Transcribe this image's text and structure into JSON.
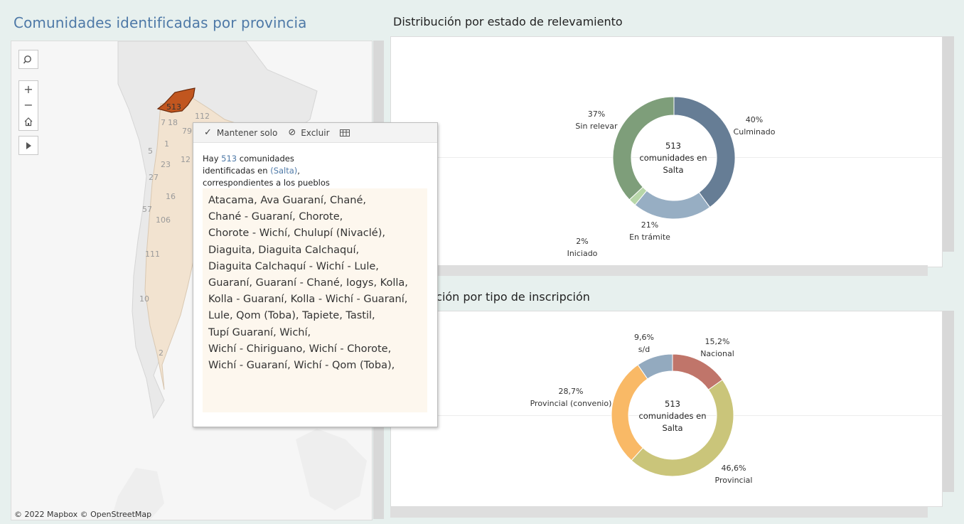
{
  "left": {
    "title": "Comunidades identificadas por provincia",
    "map_labels": [
      "513",
      "112",
      "7",
      "18",
      "79",
      "5",
      "1",
      "12",
      "27",
      "16",
      "57",
      "106",
      "111",
      "10",
      "2",
      "23"
    ],
    "attribution": "© 2022 Mapbox  © OpenStreetMap",
    "controls": {
      "search_icon": "search-icon",
      "zoom_in": "+",
      "zoom_out": "−",
      "home_icon": "home-icon",
      "play_icon": "play-icon"
    }
  },
  "tooltip": {
    "keep_only": "Mantener solo",
    "exclude": "Excluir",
    "intro_pre": "Hay ",
    "count": "513",
    "intro_mid": " comunidades",
    "intro_line2_pre": "identificadas en  ",
    "province": "(Salta)",
    "intro_line2_post": ",",
    "intro_line3": "correspondientes a los pueblos",
    "peoples": [
      "Atacama,  Ava Guaraní,  Chané,",
      "Chané - Guaraní,  Chorote,",
      "Chorote - Wichí,  Chulupí (Nivaclé),",
      "Diaguita,  Diaguita Calchaquí,",
      "Diaguita Calchaquí - Wichí  - Lule,",
      "Guaraní,  Guaraní - Chané,  Iogys,  Kolla,",
      "Kolla - Guaraní,  Kolla - Wichí - Guaraní,",
      "Lule,  Qom (Toba),  Tapiete,  Tastil,",
      "Tupí Guaraní,  Wichí,",
      "Wichí - Chiriguano,  Wichí - Chorote,",
      "Wichí - Guaraní,  Wichí - Qom (Toba),"
    ]
  },
  "chart1": {
    "title": "Distribución por estado de relevamiento",
    "center": [
      "513",
      "comunidades en",
      "Salta"
    ],
    "labels": {
      "culminado_pct": "40%",
      "culminado": "Culminado",
      "sin_relevar_pct": "37%",
      "sin_relevar": "Sin relevar",
      "en_tramite_pct": "21%",
      "en_tramite": "En trámite",
      "iniciado_pct": "2%",
      "iniciado": "Iniciado"
    }
  },
  "chart2": {
    "title": "ución por tipo de inscripción",
    "center": [
      "513",
      "comunidades en",
      "Salta"
    ],
    "labels": {
      "nacional_pct": "15,2%",
      "nacional": "Nacional",
      "provincial_pct": "46,6%",
      "provincial": "Provincial",
      "convenio_pct": "28,7%",
      "convenio": "Provincial (convenio)",
      "sd_pct": "9,6%",
      "sd": "s/d"
    }
  },
  "chart_data": [
    {
      "type": "pie",
      "title": "Distribución por estado de relevamiento",
      "categories": [
        "Culminado",
        "En trámite",
        "Iniciado",
        "Sin relevar"
      ],
      "values": [
        40,
        21,
        2,
        37
      ],
      "colors": [
        "#667d95",
        "#97aec3",
        "#b7d6a8",
        "#7e9e7a"
      ]
    },
    {
      "type": "pie",
      "title": "ución por tipo de inscripción",
      "categories": [
        "Nacional",
        "Provincial",
        "Provincial (convenio)",
        "s/d"
      ],
      "values": [
        15.2,
        46.6,
        28.7,
        9.6
      ],
      "colors": [
        "#c0756a",
        "#cac57a",
        "#f9b966",
        "#93aabf"
      ]
    }
  ]
}
